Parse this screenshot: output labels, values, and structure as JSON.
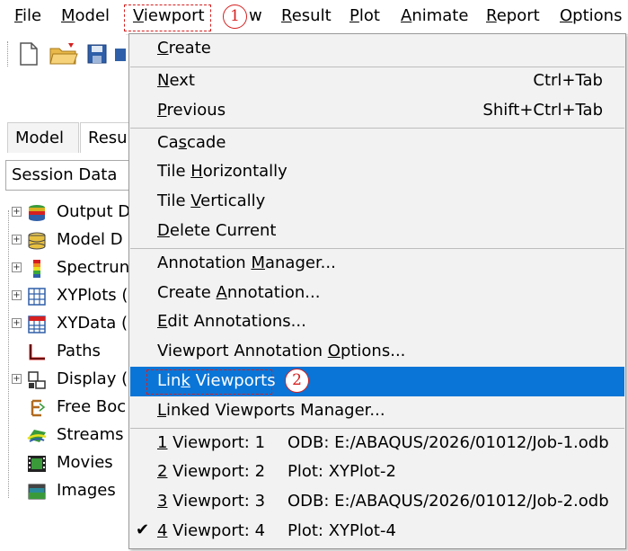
{
  "menubar": {
    "items": [
      {
        "label": "File",
        "mnemonic": "F"
      },
      {
        "label": "Model",
        "mnemonic": "M"
      },
      {
        "label": "Viewport",
        "mnemonic": "V"
      },
      {
        "label": "w"
      },
      {
        "label": "Result",
        "mnemonic": "R"
      },
      {
        "label": "Plot",
        "mnemonic": "P"
      },
      {
        "label": "Animate",
        "mnemonic": "A"
      },
      {
        "label": "Report",
        "mnemonic": "R"
      },
      {
        "label": "Options",
        "mnemonic": "O"
      }
    ]
  },
  "callouts": {
    "one": "1",
    "two": "2"
  },
  "left_panel": {
    "tabs": [
      "Model",
      "Resu"
    ],
    "session_select": "Session Data",
    "tree": [
      {
        "label": "Output D",
        "icon": "database-stack-icon",
        "expandable": true
      },
      {
        "label": "Model D",
        "icon": "model-database-icon",
        "expandable": true
      },
      {
        "label": "Spectrun",
        "icon": "spectrum-icon",
        "expandable": true
      },
      {
        "label": "XYPlots (",
        "icon": "grid-plot-icon",
        "expandable": true
      },
      {
        "label": "XYData (",
        "icon": "xy-data-icon",
        "expandable": true
      },
      {
        "label": "Paths",
        "icon": "path-icon",
        "expandable": false
      },
      {
        "label": "Display (",
        "icon": "display-group-icon",
        "expandable": true
      },
      {
        "label": "Free Boc",
        "icon": "free-body-icon",
        "expandable": false
      },
      {
        "label": "Streams",
        "icon": "streams-icon",
        "expandable": false
      },
      {
        "label": "Movies",
        "icon": "film-icon",
        "expandable": false
      },
      {
        "label": "Images",
        "icon": "image-icon",
        "expandable": false
      }
    ]
  },
  "viewport_menu": {
    "create": "Create",
    "next": "Next",
    "next_shortcut": "Ctrl+Tab",
    "previous": "Previous",
    "previous_shortcut": "Shift+Ctrl+Tab",
    "cascade": "Cascade",
    "tile_h": "Tile Horizontally",
    "tile_v": "Tile Vertically",
    "delete_current": "Delete Current",
    "annotation_manager": "Annotation Manager...",
    "create_annotation": "Create Annotation...",
    "edit_annotations": "Edit Annotations...",
    "viewport_annotation_options": "Viewport Annotation Options...",
    "link_viewports": "Link Viewports",
    "linked_manager": "Linked Viewports Manager...",
    "viewports": [
      {
        "num": "1",
        "name": " Viewport: 1",
        "source": "ODB: E:/ABAQUS/2026/01012/Job-1.odb",
        "checked": false
      },
      {
        "num": "2",
        "name": " Viewport: 2",
        "source": "Plot: XYPlot-2",
        "checked": false
      },
      {
        "num": "3",
        "name": " Viewport: 3",
        "source": "ODB: E:/ABAQUS/2026/01012/Job-2.odb",
        "checked": false
      },
      {
        "num": "4",
        "name": " Viewport: 4",
        "source": "Plot: XYPlot-4",
        "checked": true
      }
    ],
    "check_glyph": "✔"
  },
  "colors": {
    "highlight": "#0a75d6",
    "callout": "#d62020"
  }
}
